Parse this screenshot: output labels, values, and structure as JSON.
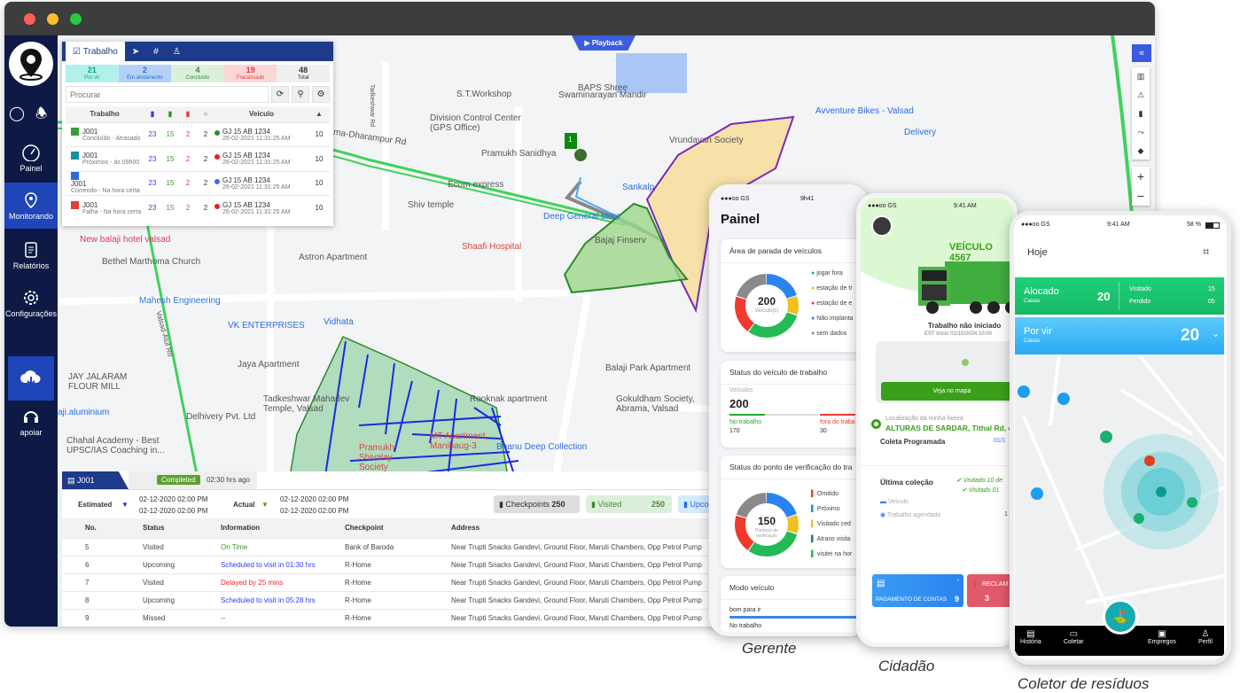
{
  "sidebar": {
    "items": [
      {
        "label": "Painel"
      },
      {
        "label": "Monitorando"
      },
      {
        "label": "Relatórios"
      },
      {
        "label": "Configurações"
      }
    ],
    "support": "apoiar"
  },
  "map": {
    "playback": "Playback",
    "labels": [
      "S.T.Workshop",
      "Swaminarayan Mandir",
      "BAPS Shree",
      "Division Control Center (GPS Office)",
      "Pramukh Sanidhya",
      "Vrundavan Society",
      "Avventure Bikes - Valsad",
      "Delivery",
      "Ecom express",
      "Shiv temple",
      "Sankalp",
      "Deep General store",
      "Shaafi Hospital",
      "Bajaj Finserv",
      "New balaji hotel valsad",
      "Bethel Marthoma Church",
      "Astron Apartment",
      "Mahesh Engineering",
      "VK ENTERPRISES",
      "Vidhata",
      "Jaya Apartment",
      "JAY JALARAM FLOUR MILL",
      "Tadkeshwar Mahadev Temple, Valsad",
      "Delhivery Pvt. Ltd",
      "Chahal Academy - Best UPSC/IAS Coaching in...",
      "Balaji Park Apartment",
      "Gokuldham Society, Abrama, Valsad",
      "Bhanu Deep Collection",
      "Pramukh Shivalay Society",
      "MT Apartment, Manibaug-3",
      "Tadkeshwar Rd",
      "Valsad-Atul Rd",
      "ma-Dharampur Rd",
      "Rooknak apartment",
      "aji.aluminium"
    ],
    "marker_count": "1"
  },
  "panel": {
    "tabs": [
      "Trabalho"
    ],
    "stats": [
      {
        "n": "21",
        "l": "Por vir",
        "bg": "#b2f0ea",
        "c": "#1a9e8c"
      },
      {
        "n": "2",
        "l": "Em andamento",
        "bg": "#b3d1f7",
        "c": "#2c6bd6"
      },
      {
        "n": "4",
        "l": "Concluído",
        "bg": "#dcefdc",
        "c": "#3b8c3b"
      },
      {
        "n": "19",
        "l": "Fracassado",
        "bg": "#fbd6d6",
        "c": "#e53b3b"
      },
      {
        "n": "48",
        "l": "Total",
        "bg": "#efefef",
        "c": "#333"
      }
    ],
    "search_placeholder": "Procurar",
    "headers": {
      "job": "Trabalho",
      "vehicle": "Veículo"
    },
    "rows": [
      {
        "job": "J001",
        "status": "Concluído - Atrasado",
        "icon": "#3b9a3b",
        "a": "23",
        "b": "15",
        "c": "2",
        "d": "2",
        "dot": "#2e8b2e",
        "veh": "GJ 15 AB 1234",
        "time": "26-02-2021 11:31:25 AM",
        "alerts": "10"
      },
      {
        "job": "J001",
        "status": "Próximos - às 09h00",
        "icon": "#1a8fa0",
        "a": "23",
        "b": "15",
        "c": "2",
        "d": "2",
        "dot": "#e82020",
        "veh": "GJ 15 AB 1234",
        "time": "26-02-2021 11:31:25 AM",
        "alerts": "10"
      },
      {
        "job": "J001",
        "status": "Correndo - Na hora certa",
        "icon": "#2a6be0",
        "a": "23",
        "b": "15",
        "c": "2",
        "d": "2",
        "dot": "#3a6fe0",
        "veh": "GJ 15 AB 1234",
        "time": "26-02-2021 11:31:25 AM",
        "alerts": "10"
      },
      {
        "job": "J001",
        "status": "Falha - Na hora certa",
        "icon": "#e53b3b",
        "a": "23",
        "b": "15",
        "c": "2",
        "d": "2",
        "dot": "#e82020",
        "veh": "GJ 15 AB 1234",
        "time": "26-02-2021 11:31:25 AM",
        "alerts": "10"
      }
    ]
  },
  "bottom": {
    "job": "J001",
    "badge": "Completed",
    "ago": "02:30 hrs ago",
    "estimated": "Estimated",
    "actual": "Actual",
    "est1": "02-12-2020 02:00 PM",
    "est2": "02-12-2020 02:00 PM",
    "act1": "02-12-2020 02:00 PM",
    "act2": "02-12-2020 02:00 PM",
    "checkpoints_label": "Checkpoints",
    "checkpoints": "250",
    "visited_label": "Visited",
    "visited": "250",
    "upcoming_label": "Upco",
    "headers": [
      "No.",
      "Status",
      "Information",
      "Checkpoint",
      "Address"
    ],
    "rows": [
      {
        "no": "5",
        "status": "Visited",
        "info": "On Time",
        "color": "#3a9a1a",
        "cp": "Bank of Baroda",
        "addr": "Near Trupti Snacks Gandevi, Ground Floor, Maruti Chambers, Opp Petrol Pump"
      },
      {
        "no": "6",
        "status": "Upcoming",
        "info": "Scheduled to visit in 01:30 hrs",
        "color": "#2a3cf0",
        "cp": "R-Home",
        "addr": "Near Trupti Snacks Gandevi, Ground Floor, Maruti Chambers, Opp Petrol Pump"
      },
      {
        "no": "7",
        "status": "Visited",
        "info": "Delayed by 25 mins",
        "color": "#f02a2a",
        "cp": "R-Home",
        "addr": "Near Trupti Snacks Gandevi, Ground Floor, Maruti Chambers, Opp Petrol Pump"
      },
      {
        "no": "8",
        "status": "Upcoming",
        "info": "Scheduled to visit in 05:28 hrs",
        "color": "#2a3cf0",
        "cp": "R-Home",
        "addr": "Near Trupti Snacks Gandevi, Ground Floor, Maruti Chambers, Opp Petrol Pump"
      },
      {
        "no": "9",
        "status": "Missed",
        "info": "--",
        "color": "#444",
        "cp": "R-Home",
        "addr": "Near Trupti Snacks Gandevi, Ground Floor, Maruti Chambers, Opp Petrol Pump"
      }
    ]
  },
  "gerente": {
    "carrier": "●●●oo GS",
    "time": "9h41",
    "title": "Painel",
    "card1": {
      "title": "Área de parada de veículos",
      "value": "200",
      "unit": "Veículo(s)",
      "legend": [
        "jogar fora",
        "estação de tr",
        "estação de e",
        "Não implanta",
        "sem dados"
      ]
    },
    "card2": {
      "title": "Status do veículo de trabalho",
      "label": "Veículos",
      "value": "200",
      "on_label": "No trabalho",
      "on": "170",
      "off_label": "fora do traba",
      "off": "30"
    },
    "card3": {
      "title": "Status do ponto de verificação do tra",
      "value": "150",
      "unit": "Ponto(s) de verificação",
      "legend": [
        "Omitido",
        "Próximo",
        "Visitado ced",
        "Atraso visita",
        "visitei na hor"
      ]
    },
    "card4": {
      "title": "Modo veículo",
      "a": "bom para ir",
      "b": "No trabalho"
    },
    "caption": "Gerente"
  },
  "cidadao": {
    "carrier": "●●●oo GS",
    "time": "9:41 AM",
    "vehicle": "VEÍCULO 4567",
    "status": "Trabalho não iniciado",
    "est": "EST Início 01/10/2024 10:00",
    "map_btn": "Veja no mapa",
    "loc_label": "Localização da minha lixeira",
    "loc": "ALTURAS DE SARDAR, Tithal Rd, c",
    "sched": "Coleta Programada",
    "sched_date": "01/1",
    "last": "Última coleção",
    "v1": "Visitado  10 de",
    "v2": "Visitado  01",
    "veh": "Veículo",
    "job": "Trabalho agendado",
    "job_val": "1",
    "pay": "PAGAMENTO DE CONTAS",
    "pay_n": "9",
    "rec": "RECLAM",
    "rec_n": "3",
    "caption": "Cidadão"
  },
  "coletor": {
    "carrier": "●●●oo GS",
    "time": "9:41 AM",
    "battery": "58 %",
    "title": "Hoje",
    "alloc": "Alocado",
    "alloc_sub": "Caixas",
    "alloc_n": "20",
    "visited": "Visitado",
    "visited_n": "15",
    "lost": "Perdido",
    "lost_n": "05",
    "upcoming": "Por vir",
    "upcoming_sub": "Caixas",
    "upcoming_n": "20",
    "nav": [
      "História",
      "Coletar",
      "Empregos",
      "Perfil"
    ],
    "caption": "Coletor de resíduos"
  },
  "colors": {
    "navy": "#0e1a45",
    "accent": "#1e3a8a",
    "green": "#22b24c",
    "blue": "#2aa9f5"
  },
  "donut_segments": [
    {
      "color": "#2a84f0",
      "v": 20
    },
    {
      "color": "#f0c020",
      "v": 10
    },
    {
      "color": "#22bb55",
      "v": 30
    },
    {
      "color": "#f03a30",
      "v": 20
    },
    {
      "color": "#8a8a8a",
      "v": 20
    }
  ]
}
